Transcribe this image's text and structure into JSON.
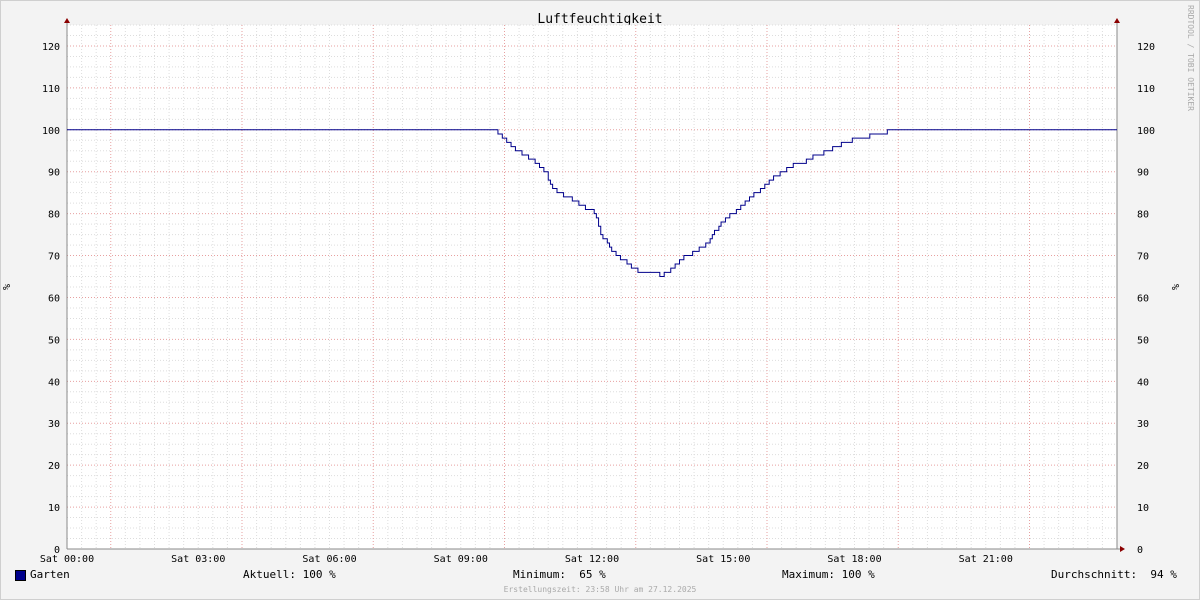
{
  "chart_data": {
    "type": "line",
    "title": "Luftfeuchtigkeit",
    "ylabel": "%",
    "ylim": [
      0,
      125
    ],
    "yticks": [
      0,
      10,
      20,
      30,
      40,
      50,
      60,
      70,
      80,
      90,
      100,
      110,
      120
    ],
    "xlim_hours": [
      0,
      24
    ],
    "xticks": [
      {
        "hour": 0,
        "label": "Sat 00:00"
      },
      {
        "hour": 3,
        "label": "Sat 03:00"
      },
      {
        "hour": 6,
        "label": "Sat 06:00"
      },
      {
        "hour": 9,
        "label": "Sat 09:00"
      },
      {
        "hour": 12,
        "label": "Sat 12:00"
      },
      {
        "hour": 15,
        "label": "Sat 15:00"
      },
      {
        "hour": 18,
        "label": "Sat 18:00"
      },
      {
        "hour": 21,
        "label": "Sat 21:00"
      }
    ],
    "grid": true,
    "series": [
      {
        "name": "Garten",
        "color": "#00008b",
        "points": [
          [
            0,
            100
          ],
          [
            9.7,
            100
          ],
          [
            9.85,
            99
          ],
          [
            9.95,
            98
          ],
          [
            10.05,
            97
          ],
          [
            10.15,
            96
          ],
          [
            10.25,
            95
          ],
          [
            10.4,
            94
          ],
          [
            10.55,
            93
          ],
          [
            10.7,
            92
          ],
          [
            10.8,
            91
          ],
          [
            10.9,
            90
          ],
          [
            11.0,
            88
          ],
          [
            11.05,
            87
          ],
          [
            11.1,
            86
          ],
          [
            11.2,
            85
          ],
          [
            11.35,
            84
          ],
          [
            11.55,
            83
          ],
          [
            11.7,
            82
          ],
          [
            11.85,
            81
          ],
          [
            12.05,
            80
          ],
          [
            12.1,
            79
          ],
          [
            12.15,
            77
          ],
          [
            12.2,
            75
          ],
          [
            12.25,
            74
          ],
          [
            12.35,
            73
          ],
          [
            12.4,
            72
          ],
          [
            12.45,
            71
          ],
          [
            12.55,
            70
          ],
          [
            12.65,
            69
          ],
          [
            12.8,
            68
          ],
          [
            12.9,
            67
          ],
          [
            13.05,
            66
          ],
          [
            13.5,
            66
          ],
          [
            13.55,
            65
          ],
          [
            13.65,
            66
          ],
          [
            13.8,
            67
          ],
          [
            13.9,
            68
          ],
          [
            14.0,
            69
          ],
          [
            14.1,
            70
          ],
          [
            14.3,
            71
          ],
          [
            14.45,
            72
          ],
          [
            14.6,
            73
          ],
          [
            14.7,
            74
          ],
          [
            14.75,
            75
          ],
          [
            14.8,
            76
          ],
          [
            14.9,
            77
          ],
          [
            14.95,
            78
          ],
          [
            15.05,
            79
          ],
          [
            15.15,
            80
          ],
          [
            15.3,
            81
          ],
          [
            15.4,
            82
          ],
          [
            15.5,
            83
          ],
          [
            15.6,
            84
          ],
          [
            15.7,
            85
          ],
          [
            15.85,
            86
          ],
          [
            15.95,
            87
          ],
          [
            16.05,
            88
          ],
          [
            16.15,
            89
          ],
          [
            16.3,
            90
          ],
          [
            16.45,
            91
          ],
          [
            16.6,
            92
          ],
          [
            16.9,
            93
          ],
          [
            17.05,
            94
          ],
          [
            17.3,
            95
          ],
          [
            17.5,
            96
          ],
          [
            17.7,
            97
          ],
          [
            17.95,
            98
          ],
          [
            18.35,
            99
          ],
          [
            18.75,
            100
          ],
          [
            24,
            100
          ]
        ]
      }
    ],
    "watermark": "RRDTOOL / TOBI OETIKER"
  },
  "legend": {
    "series_name": "Garten",
    "current": "Aktuell: 100 %",
    "minimum": "Minimum:  65 %",
    "maximum": "Maximum: 100 %",
    "average": "Durchschnitt:  94 %"
  },
  "footer": "Erstellungszeit: 23:58 Uhr am 27.12.2025"
}
